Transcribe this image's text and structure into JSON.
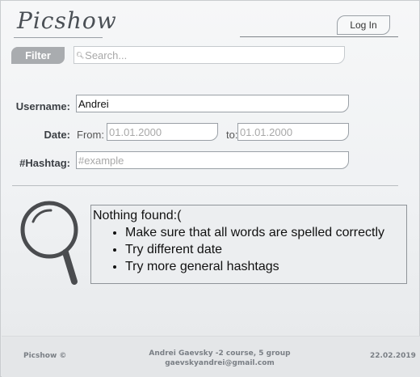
{
  "header": {
    "logo": "Picshow",
    "login_label": "Log In"
  },
  "search": {
    "filter_label": "Filter",
    "placeholder": "Search...",
    "icon": "magnifier-icon"
  },
  "form": {
    "username_label": "Username:",
    "username_value": "Andrei",
    "date_label": "Date:",
    "from_label": "From:",
    "from_placeholder": "01.01.2000",
    "to_label": "to:",
    "to_placeholder": "01.01.2000",
    "hashtag_label": "#Hashtag:",
    "hashtag_placeholder": "#example"
  },
  "results": {
    "icon": "magnifying-glass-icon",
    "title": "Nothing found:(",
    "tips": [
      "Make sure that all words are spelled correctly",
      "Try different date",
      "Try more general hashtags"
    ]
  },
  "footer": {
    "brand": "Picshow ©",
    "author_line1": "Andrei Gaevsky -2 course, 5 group",
    "author_line2": "gaevskyandrei@gmail.com",
    "date": "22.02.2019"
  }
}
